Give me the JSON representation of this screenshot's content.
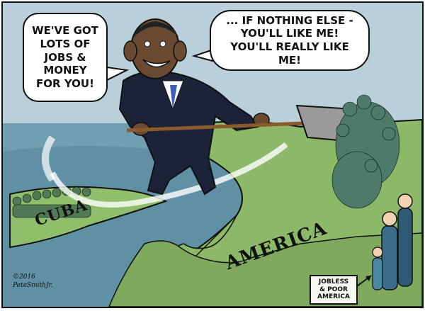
{
  "speech": {
    "left": "WE'VE GOT\nLOTS OF\nJOBS &\nMONEY\nFOR YOU!",
    "right": "... IF NOTHING ELSE -\nYOU'LL LIKE ME!\nYOU'LL REALLY LIKE ME!"
  },
  "labels": {
    "cuba": "CUBA",
    "america": "AMERICA"
  },
  "sign": {
    "line1": "JOBLESS",
    "line2": "& POOR",
    "line3": "AMERICA"
  },
  "signature": {
    "year": "©2016",
    "artist": "PeteSmithJr."
  },
  "colors": {
    "sea": "#6f9fb0",
    "sky": "#b8cfd9",
    "land": "#8cb968",
    "suit": "#1c2238",
    "shovel": "#8a8a8a"
  }
}
